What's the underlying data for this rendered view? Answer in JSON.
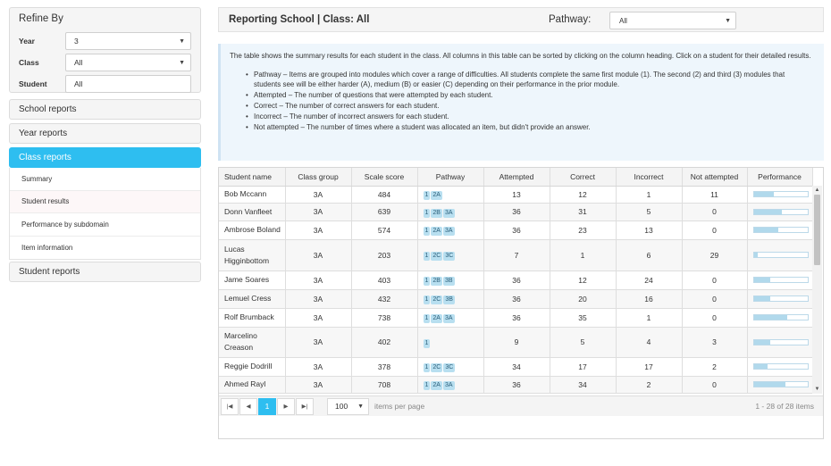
{
  "sidebar": {
    "refine_title": "Refine By",
    "filters": [
      {
        "label": "Year",
        "value": "3",
        "type": "select"
      },
      {
        "label": "Class",
        "value": "All",
        "type": "select"
      },
      {
        "label": "Student",
        "value": "All",
        "type": "input"
      }
    ],
    "panels": {
      "school": "School reports",
      "year": "Year reports",
      "class": "Class reports",
      "student": "Student reports"
    },
    "class_items": [
      "Summary",
      "Student results",
      "Performance by subdomain",
      "Item information"
    ]
  },
  "header": {
    "title": "Reporting School | Class: All",
    "pathway_label": "Pathway:",
    "pathway_value": "All"
  },
  "info": {
    "intro": "The table shows the summary results for each student in the class. All columns in this table can be sorted by clicking on the column heading. Click on a student for their detailed results.",
    "bullets": [
      "Pathway – Items are grouped into modules which cover a range of difficulties. All students complete the same first module (1). The second (2) and third (3) modules that students see will be either harder (A), medium (B) or easier (C) depending on their performance in the prior module.",
      "Attempted – The number of questions that were attempted by each student.",
      "Correct – The number of correct answers for each student.",
      "Incorrect – The number of incorrect answers for each student.",
      "Not attempted – The number of times where a student was allocated an item, but didn't provide an answer."
    ]
  },
  "table": {
    "columns": [
      "Student name",
      "Class group",
      "Scale score",
      "Pathway",
      "Attempted",
      "Correct",
      "Incorrect",
      "Not attempted",
      "Performance"
    ],
    "rows": [
      {
        "name": "Bob Mccann",
        "group": "3A",
        "score": "484",
        "pathway": [
          "1",
          "2A"
        ],
        "attempted": "13",
        "correct": "12",
        "incorrect": "1",
        "not_attempted": "11",
        "perf": 0.37
      },
      {
        "name": "Donn Vanfleet",
        "group": "3A",
        "score": "639",
        "pathway": [
          "1",
          "2B",
          "3A"
        ],
        "attempted": "36",
        "correct": "31",
        "incorrect": "5",
        "not_attempted": "0",
        "perf": 0.53
      },
      {
        "name": "Ambrose Boland",
        "group": "3A",
        "score": "574",
        "pathway": [
          "1",
          "2A",
          "3A"
        ],
        "attempted": "36",
        "correct": "23",
        "incorrect": "13",
        "not_attempted": "0",
        "perf": 0.46
      },
      {
        "name": "Lucas Higginbottom",
        "group": "3A",
        "score": "203",
        "pathway": [
          "1",
          "2C",
          "3C"
        ],
        "attempted": "7",
        "correct": "1",
        "incorrect": "6",
        "not_attempted": "29",
        "perf": 0.07
      },
      {
        "name": "Jame Soares",
        "group": "3A",
        "score": "403",
        "pathway": [
          "1",
          "2B",
          "3B"
        ],
        "attempted": "36",
        "correct": "12",
        "incorrect": "24",
        "not_attempted": "0",
        "perf": 0.3
      },
      {
        "name": "Lemuel Cress",
        "group": "3A",
        "score": "432",
        "pathway": [
          "1",
          "2C",
          "3B"
        ],
        "attempted": "36",
        "correct": "20",
        "incorrect": "16",
        "not_attempted": "0",
        "perf": 0.31
      },
      {
        "name": "Rolf Brumback",
        "group": "3A",
        "score": "738",
        "pathway": [
          "1",
          "2A",
          "3A"
        ],
        "attempted": "36",
        "correct": "35",
        "incorrect": "1",
        "not_attempted": "0",
        "perf": 0.62
      },
      {
        "name": "Marcelino Creason",
        "group": "3A",
        "score": "402",
        "pathway": [
          "1"
        ],
        "attempted": "9",
        "correct": "5",
        "incorrect": "4",
        "not_attempted": "3",
        "perf": 0.3
      },
      {
        "name": "Reggie Dodrill",
        "group": "3A",
        "score": "378",
        "pathway": [
          "1",
          "2C",
          "3C"
        ],
        "attempted": "34",
        "correct": "17",
        "incorrect": "17",
        "not_attempted": "2",
        "perf": 0.26
      },
      {
        "name": "Ahmed Rayl",
        "group": "3A",
        "score": "708",
        "pathway": [
          "1",
          "2A",
          "3A"
        ],
        "attempted": "36",
        "correct": "34",
        "incorrect": "2",
        "not_attempted": "0",
        "perf": 0.59
      }
    ]
  },
  "pager": {
    "current_page": "1",
    "page_size": "100",
    "items_per_page": "items per page",
    "range": "1 - 28 of 28 items"
  },
  "colors": {
    "accent": "#2ebef0",
    "chip": "#b8dff0",
    "perf_fill": "#b1d9ec",
    "info_bg": "#eef6fc"
  }
}
